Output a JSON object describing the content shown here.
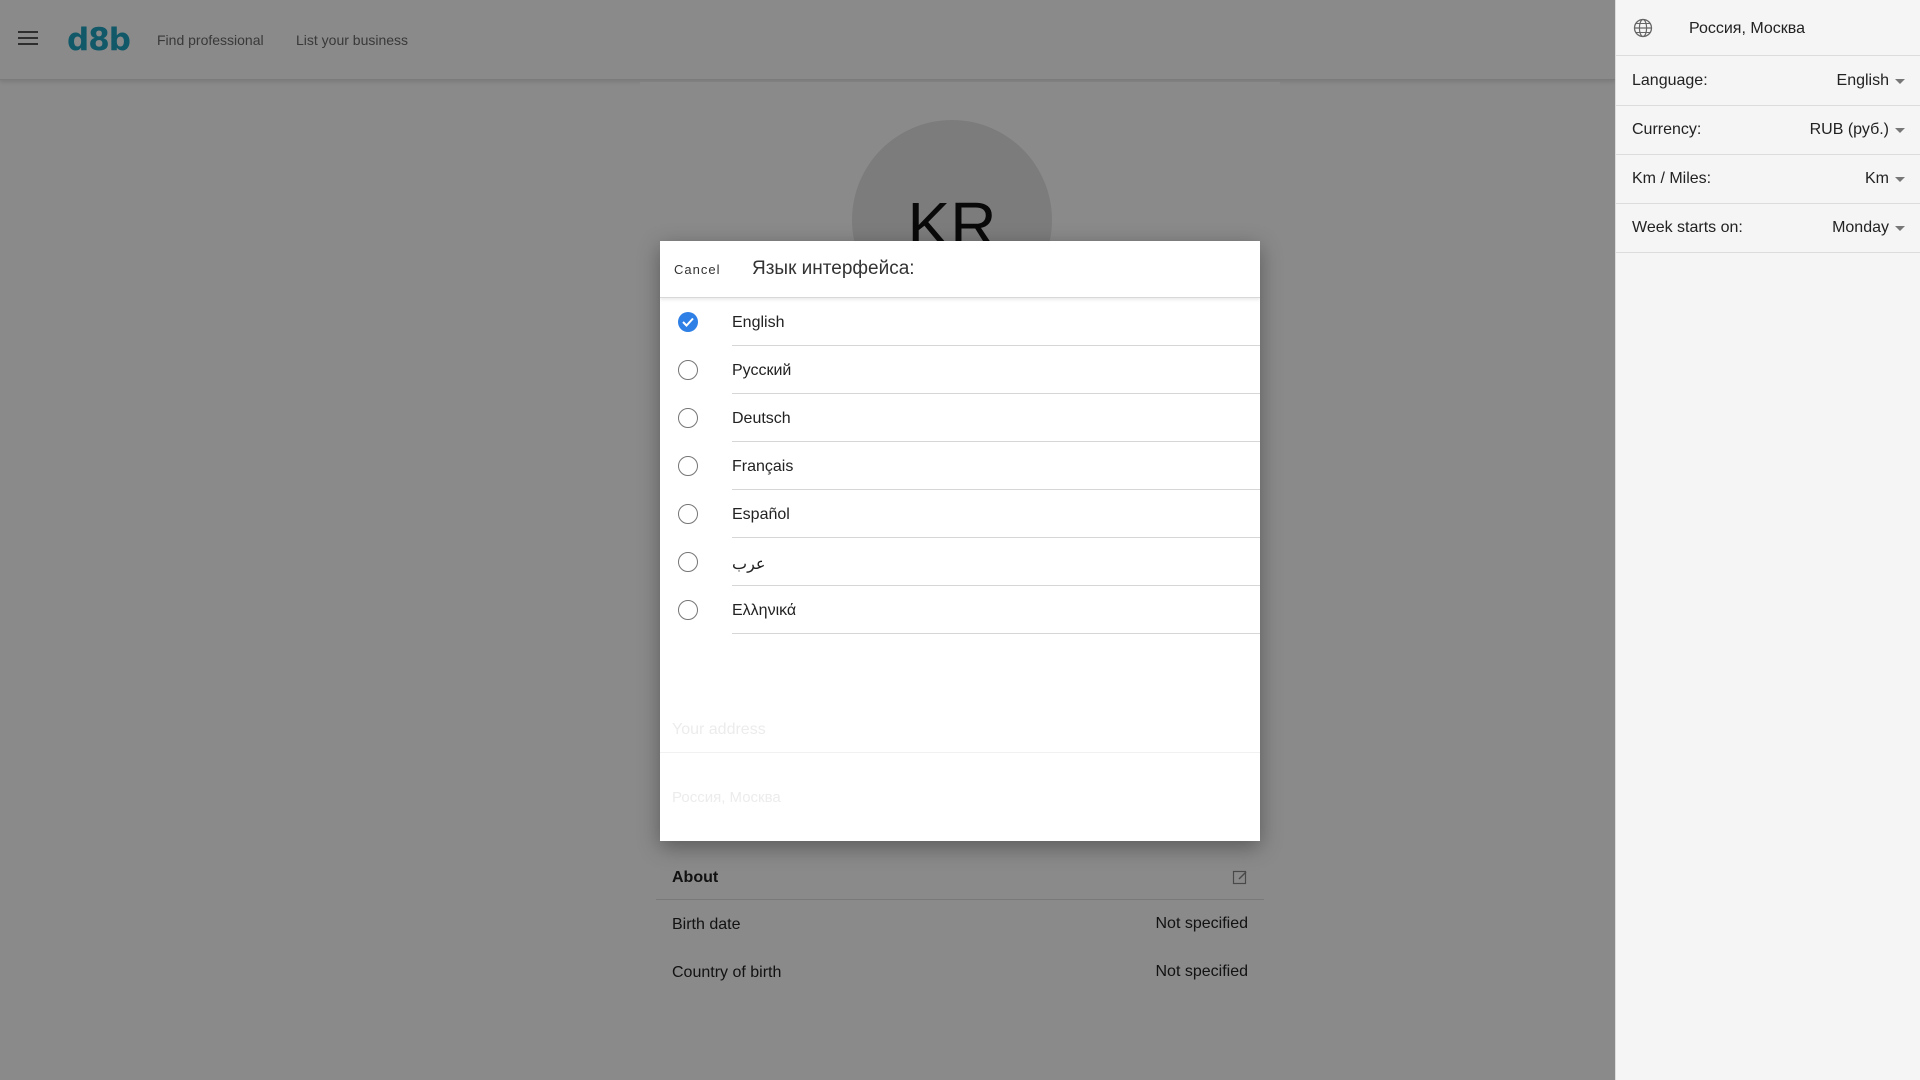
{
  "header": {
    "logo": "d8b",
    "nav": [
      "Find professional",
      "List your business"
    ]
  },
  "profile": {
    "initials": "KR",
    "about_title": "About",
    "info": [
      {
        "label": "Birth date",
        "value": "Not specified"
      },
      {
        "label": "Country of birth",
        "value": "Not specified"
      }
    ],
    "background_address_label": "Your address",
    "background_address_value": "Россия, Москва"
  },
  "settings": {
    "location": "Россия, Москва",
    "rows": [
      {
        "label": "Language:",
        "value": "English"
      },
      {
        "label": "Currency:",
        "value": "RUB (руб.)"
      },
      {
        "label": "Km / Miles:",
        "value": "Km"
      },
      {
        "label": "Week starts on:",
        "value": "Monday"
      }
    ]
  },
  "modal": {
    "cancel_label": "Cancel",
    "title": "Язык интерфейса:",
    "selected": "English",
    "languages": [
      "English",
      "Русский",
      "Deutsch",
      "Français",
      "Español",
      "عرب",
      "Ελληνικά"
    ]
  },
  "colors": {
    "brand": "#21a3c1",
    "radio_checked": "#2e7fe6",
    "overlay": "rgba(0,0,0,0.46)"
  }
}
